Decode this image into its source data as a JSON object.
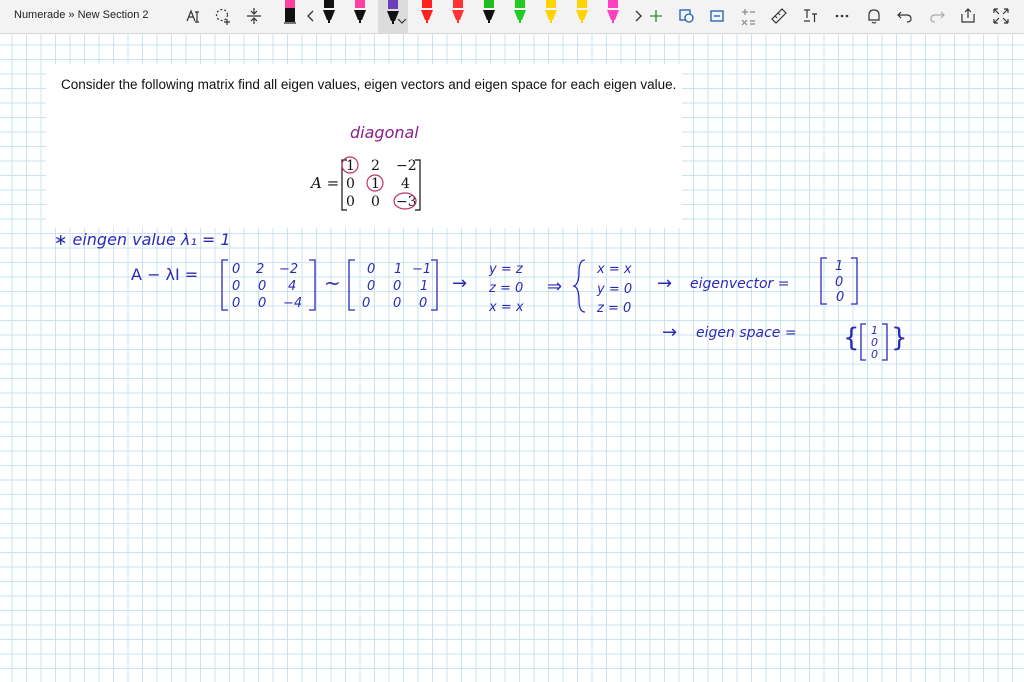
{
  "app": {
    "breadcrumb": "Numerade » New Section 2"
  },
  "toolbar": {
    "icons": [
      "lasso-select-icon",
      "add-space-icon",
      "insert-space-icon",
      "pen-icon",
      "more-left-icon",
      "more-right-icon",
      "add-pen-icon",
      "ruler-icon",
      "ink-to-text-icon",
      "math-icon",
      "more-icon",
      "bell-icon",
      "undo-icon",
      "redo-icon",
      "share-icon",
      "expand-icon"
    ],
    "pen_colors": [
      "#111111",
      "#111111",
      "#ff40a0",
      "#111111",
      "#ff2020",
      "#ff3333",
      "#111111",
      "#22bb22",
      "#22cc22",
      "#ffd400",
      "#ffd400",
      "#ff9f1a",
      "#ff40c0"
    ]
  },
  "question": {
    "text": "Consider the following matrix find all eigen values, eigen vectors and eigen space for each eigen value.",
    "annotation": "diagonal",
    "matrix_label": "A =",
    "matrix": [
      [
        "1",
        "2",
        "−2"
      ],
      [
        "0",
        "1",
        "4"
      ],
      [
        "0",
        "0",
        "−3"
      ]
    ]
  },
  "handwriting": {
    "line1": "∗  eingen value  λ₁ = 1",
    "lhs": "A − λI =",
    "m1": [
      [
        "0",
        "2",
        "−2"
      ],
      [
        "0",
        "0",
        "4"
      ],
      [
        "0",
        "0",
        "−4"
      ]
    ],
    "tilde": "~",
    "m2": [
      [
        "0",
        "1",
        "−1"
      ],
      [
        "0",
        "0",
        "1"
      ],
      [
        "0",
        "0",
        "0"
      ]
    ],
    "arrow1": "→",
    "eqs1": [
      "y = z",
      "z = 0",
      "x = x"
    ],
    "implies": "⇒",
    "eqs2": [
      "x = x",
      "y = 0",
      "z = 0"
    ],
    "arrow2": "→",
    "eigen_vector_label": "eigenvector =",
    "eigen_vector": [
      "1",
      "0",
      "0"
    ],
    "arrow3": "→",
    "eigen_space_label": "eigen space =",
    "eigen_space": [
      "1",
      "0",
      "0"
    ]
  },
  "colors": {
    "ink": "#2b2bb8",
    "annotation": "#8a1f8a",
    "circle": "#c0306b"
  }
}
